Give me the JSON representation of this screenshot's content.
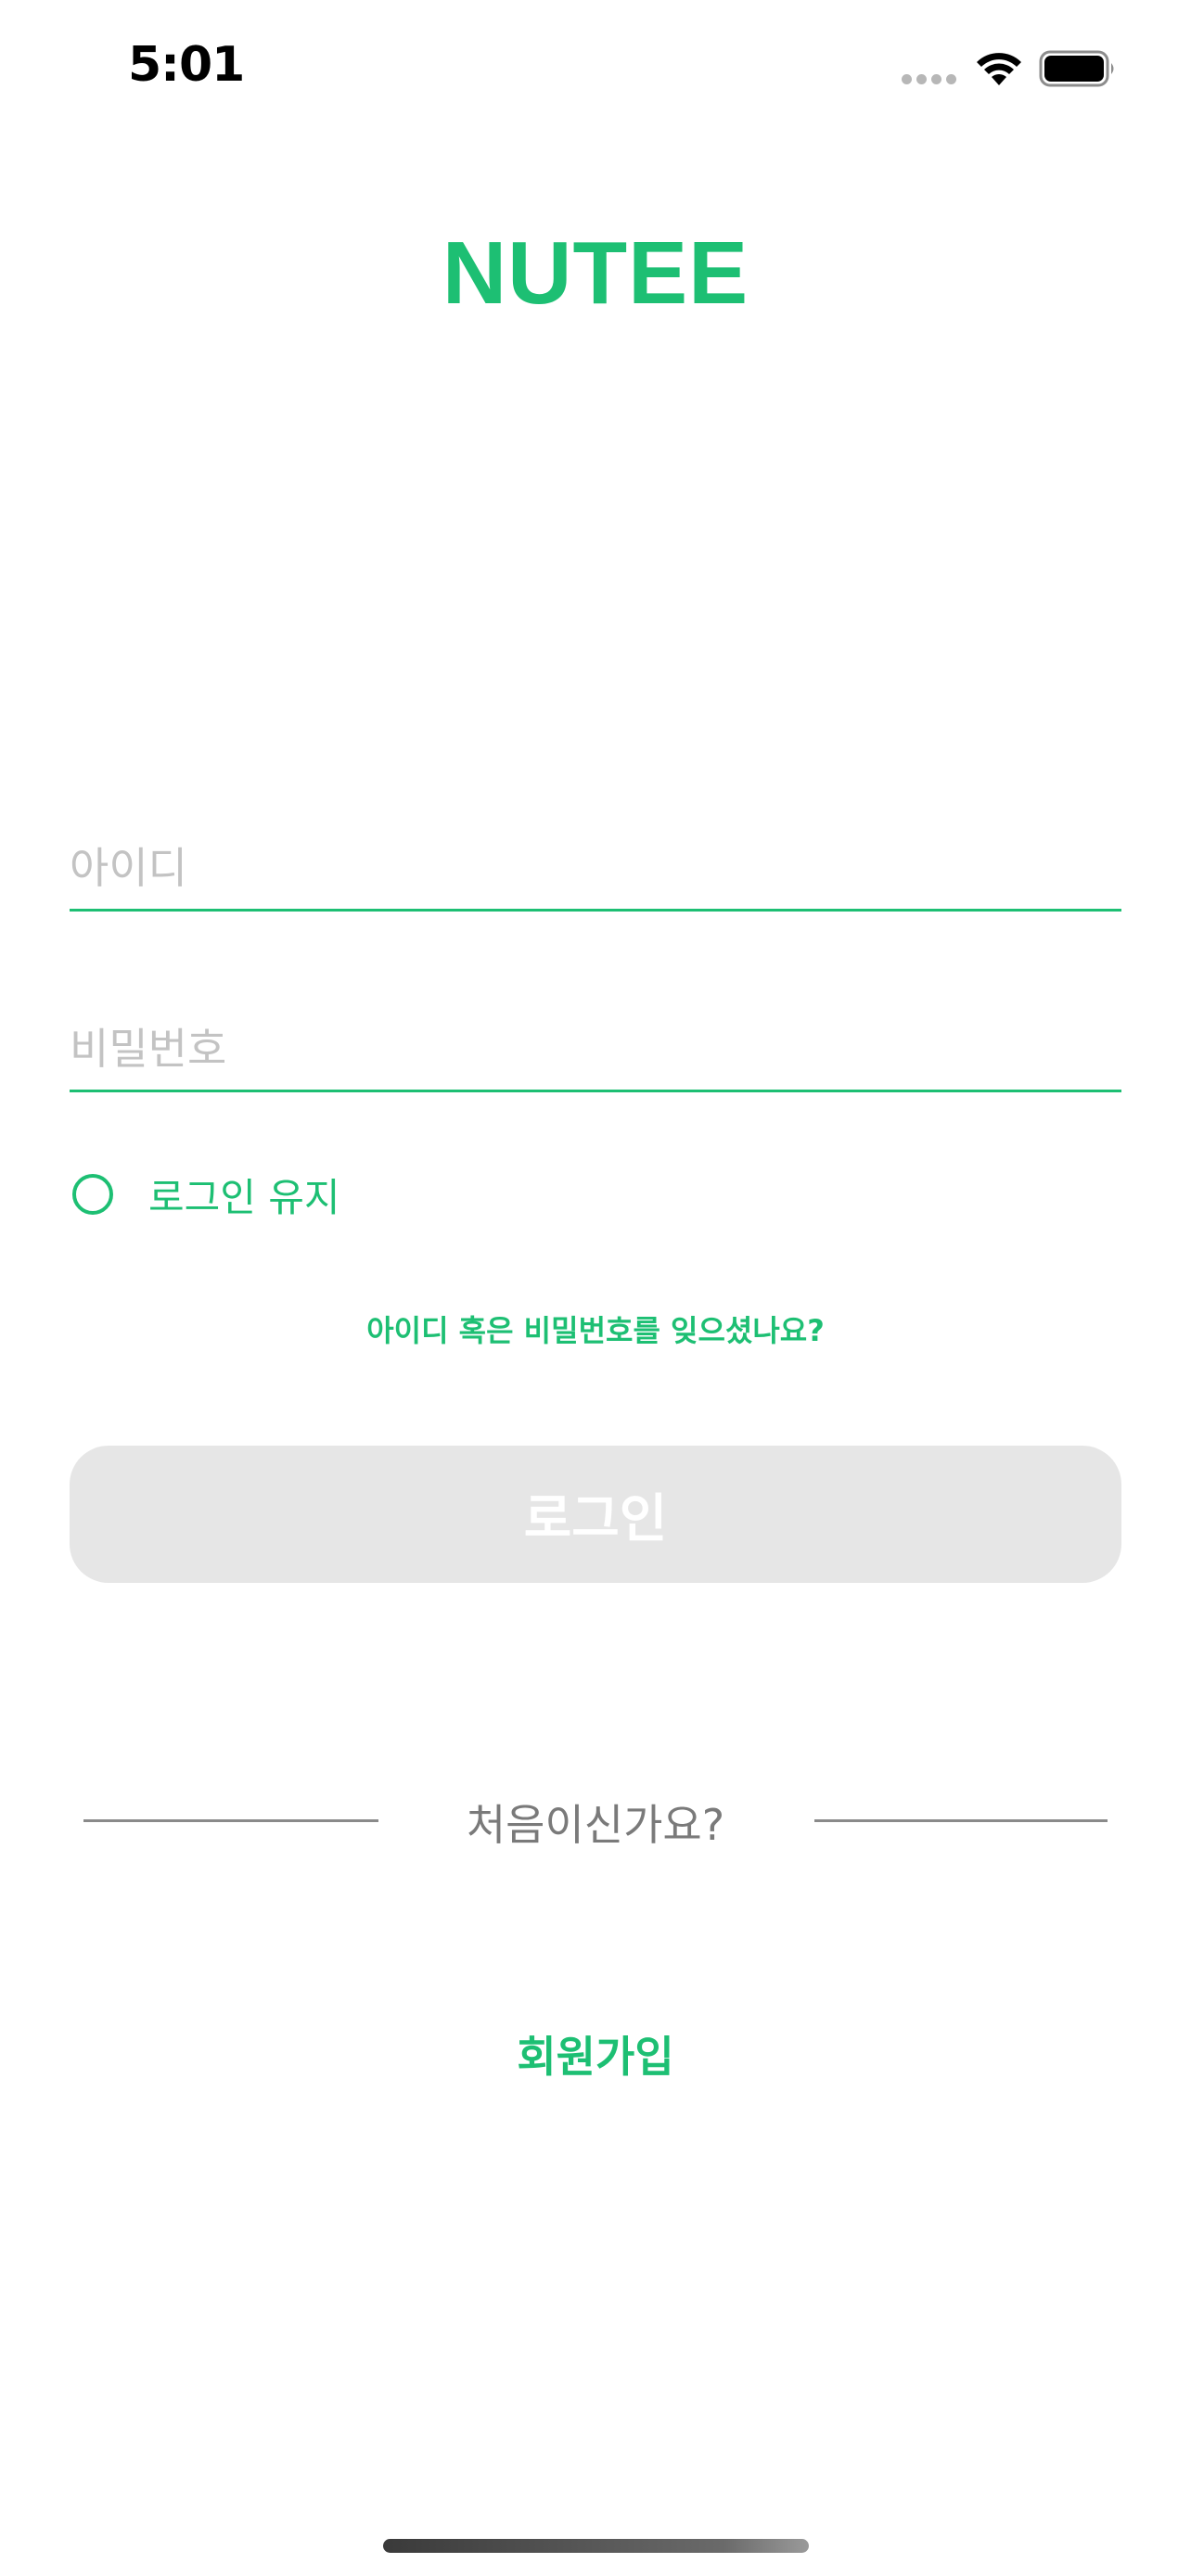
{
  "status_bar": {
    "time": "5:01"
  },
  "app": {
    "logo": "NUTEE",
    "accent_color": "#1dbf73"
  },
  "login_form": {
    "id_placeholder": "아이디",
    "password_placeholder": "비밀번호",
    "keep_login_label": "로그인 유지",
    "keep_login_checked": false,
    "forgot_link": "아이디 혹은 비밀번호를 잊으셨나요?",
    "login_button": "로그인"
  },
  "signup": {
    "prompt": "처음이신가요?",
    "link": "회원가입"
  }
}
